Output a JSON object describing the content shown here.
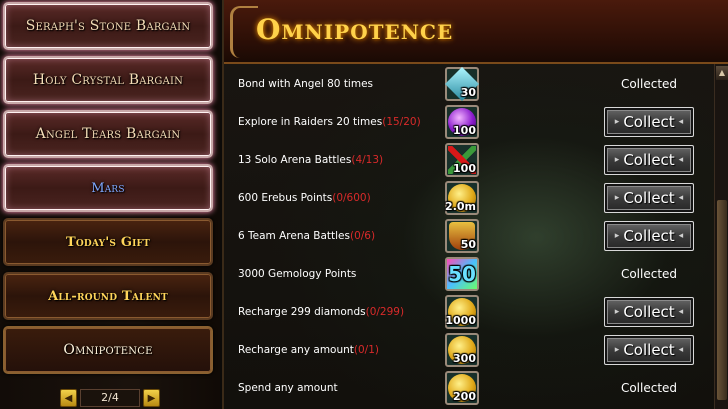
{
  "sidebar": {
    "items": [
      {
        "label": "Seraph's Stone Bargain"
      },
      {
        "label": "Holy Crystal Bargain"
      },
      {
        "label": "Angel Tears Bargain"
      },
      {
        "label": "Mars"
      },
      {
        "label": "Today's Gift"
      },
      {
        "label": "All-round Talent"
      },
      {
        "label": "Omnipotence"
      }
    ],
    "pager": {
      "text": "2/4"
    }
  },
  "main": {
    "title": "Omnipotence",
    "tasks": [
      {
        "text": "Bond with Angel 80 times",
        "progress": "",
        "reward_qty": "30",
        "reward_icon": "angel-crystal-icon",
        "status": "Collected"
      },
      {
        "text": "Explore in Raiders 20 times",
        "progress": "(15/20)",
        "reward_qty": "100",
        "reward_icon": "purple-orb-icon",
        "status": "Collect"
      },
      {
        "text": "13 Solo Arena Battles",
        "progress": "(4/13)",
        "reward_qty": "100",
        "reward_icon": "crossed-swords-icon",
        "status": "Collect"
      },
      {
        "text": "600 Erebus Points",
        "progress": "(0/600)",
        "reward_qty": "2.0m",
        "reward_icon": "gold-coin-icon",
        "status": "Collect"
      },
      {
        "text": "6 Team Arena Battles",
        "progress": "(0/6)",
        "reward_qty": "50",
        "reward_icon": "shield-badge-icon",
        "status": "Collect"
      },
      {
        "text": "3000 Gemology Points",
        "progress": "",
        "reward_qty": "50",
        "reward_icon": "gem-icon",
        "status": "Collected"
      },
      {
        "text": "Recharge 299 diamonds",
        "progress": "(0/299)",
        "reward_qty": "1000",
        "reward_icon": "gold-coin-icon",
        "status": "Collect"
      },
      {
        "text": "Recharge any amount",
        "progress": "(0/1)",
        "reward_qty": "300",
        "reward_icon": "gold-coin-icon",
        "status": "Collect"
      },
      {
        "text": "Spend any amount",
        "progress": "",
        "reward_qty": "200",
        "reward_icon": "gold-coin-icon",
        "status": "Collected"
      }
    ]
  }
}
